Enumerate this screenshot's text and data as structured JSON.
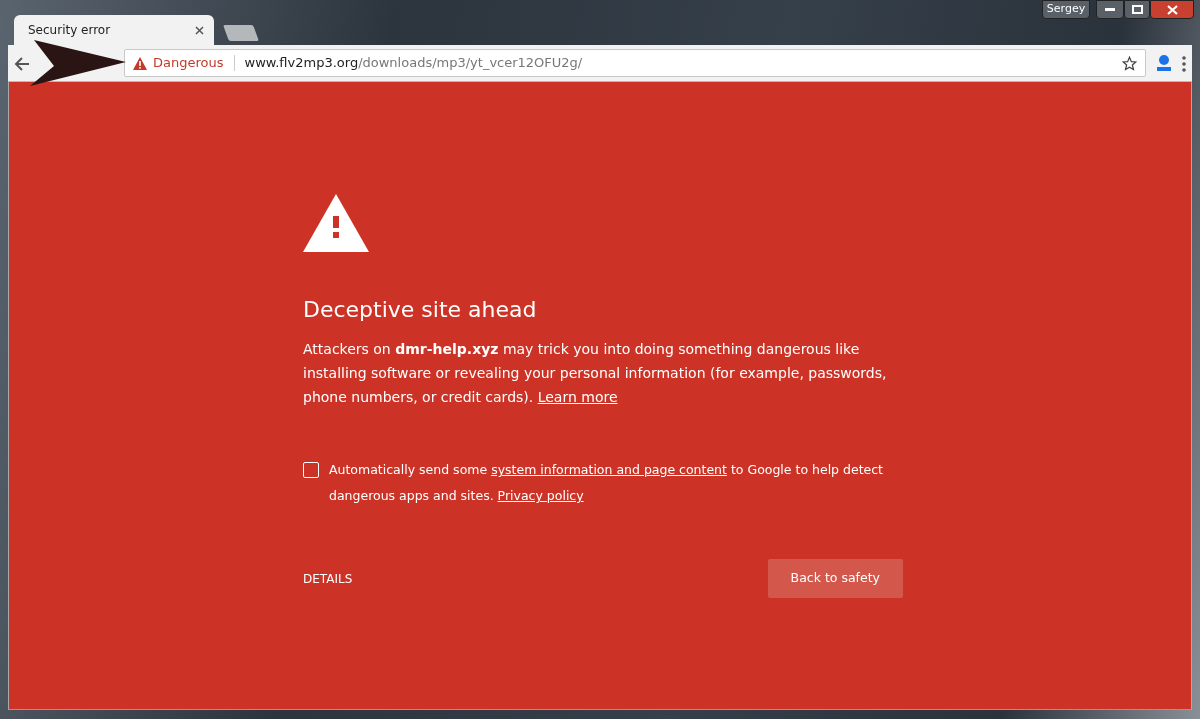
{
  "window": {
    "user": "Sergey"
  },
  "tabs": [
    {
      "title": "Security error",
      "selected": true
    },
    {
      "selected": false
    }
  ],
  "omnibox": {
    "security_label": "Dangerous",
    "host": "www.flv2mp3.org",
    "path": "/downloads/mp3/yt_vcer12OFU2g/"
  },
  "interstitial": {
    "heading": "Deceptive site ahead",
    "body": [
      {
        "kind": "text",
        "text": "Attackers on **dmr-help.xyz** may trick you into doing something dangerous like installing software or revealing your personal information (for example, passwords, phone numbers, or credit cards). "
      },
      {
        "kind": "link",
        "text": "Learn more"
      }
    ],
    "report": {
      "checked": false,
      "parts": [
        {
          "kind": "text",
          "text": "Automatically send some "
        },
        {
          "kind": "link",
          "text": "system information and page content"
        },
        {
          "kind": "text",
          "text": " to Google to help detect dangerous apps and sites. "
        },
        {
          "kind": "link",
          "text": "Privacy policy"
        }
      ]
    },
    "details": "DETAILS",
    "back_button": "Back to safety"
  }
}
